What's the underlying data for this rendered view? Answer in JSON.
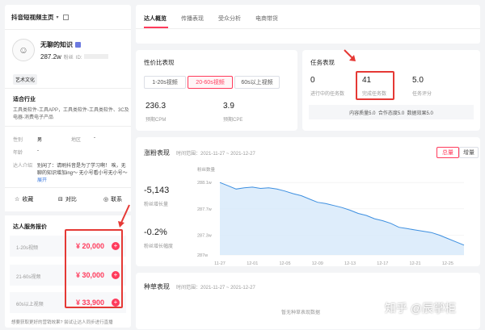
{
  "sidebar": {
    "header_title": "抖音短视频主页",
    "profile": {
      "name": "无聊的知识",
      "fans_value": "287.2w",
      "fans_label": "粉丝",
      "id_label": "ID:",
      "tag": "艺术文化"
    },
    "industry": {
      "title": "适合行业",
      "text_line1": "工具类软件-工具APP，工具类软件-工具类软件、3C及",
      "text_line2": "电器-消费电子产品"
    },
    "info": {
      "gender_label": "性别",
      "gender_value": "男",
      "region_label": "地区",
      "region_value": "-",
      "age_label": "年龄",
      "age_value": "-",
      "intro_label": "达人介绍",
      "intro_line1": "别闲了：请刷抖音是为了学习啊！ 唉，无",
      "intro_line2": "聊的知识增加ing～ 无小号看小号无小号～",
      "expand": "展开"
    },
    "actions": {
      "collect": "收藏",
      "compare": "对比",
      "contact": "联系"
    },
    "pricing": {
      "title": "达人服务报价",
      "rows": [
        {
          "label": "1-20s视频",
          "price": "¥ 20,000"
        },
        {
          "label": "21-60s视频",
          "price": "¥ 30,000"
        },
        {
          "label": "60s以上视频",
          "price": "¥ 33,900"
        }
      ],
      "footer": "想要获取更好的营销效果? 尝试让达人同步进行直播"
    }
  },
  "tabs": [
    "达人概览",
    "传播表现",
    "受众分析",
    "电商带货"
  ],
  "cost": {
    "title": "性价比表现",
    "buttons": [
      "1-20s视频",
      "20-60s视频",
      "60s以上视频"
    ],
    "cpm_value": "236.3",
    "cpm_label": "预期CPM",
    "cpe_value": "3.9",
    "cpe_label": "预期CPE"
  },
  "task": {
    "title": "任务表现",
    "in_progress_value": "0",
    "in_progress_label": "进行中的任务数",
    "done_value": "41",
    "done_label": "完成任务数",
    "score_value": "5.0",
    "score_label": "任务评分",
    "quality": "内容质量5.0  合作态度5.0  数据效果5.0"
  },
  "fans": {
    "title": "涨粉表现",
    "range": "时间范围：2021-11-27 ~ 2021-12-27",
    "toggle_total": "总量",
    "toggle_increase": "增量",
    "growth_value": "-5,143",
    "growth_label": "粉丝增长量",
    "rate_value": "-0.2%",
    "rate_label": "粉丝增长幅度",
    "axis_title": "粉丝数量"
  },
  "seed": {
    "title": "种草表现",
    "range": "时间范围：2021-11-27 ~ 2021-12-27",
    "empty": "暂无种草表现数据"
  },
  "watermark": "知乎 @辰掌柜",
  "colors": {
    "accent": "#ff3b5c",
    "highlight": "#e53935",
    "line": "#3d8fe0"
  },
  "chart_data": {
    "type": "area",
    "ylabel": "粉丝数量",
    "yticks": [
      "288.1w",
      "287.7w",
      "287.3w",
      "287w"
    ],
    "ylim": [
      287.0,
      288.2
    ],
    "x": [
      "11-27",
      "11-28",
      "11-29",
      "11-30",
      "12-01",
      "12-02",
      "12-03",
      "12-04",
      "12-05",
      "12-06",
      "12-07",
      "12-08",
      "12-09",
      "12-10",
      "12-11",
      "12-12",
      "12-13",
      "12-14",
      "12-15",
      "12-16",
      "12-17",
      "12-18",
      "12-19",
      "12-20",
      "12-21",
      "12-22",
      "12-23",
      "12-24",
      "12-25",
      "12-26",
      "12-27"
    ],
    "xticks": [
      "11-27",
      "12-01",
      "12-05",
      "12-09",
      "12-13",
      "12-17",
      "12-21",
      "12-25"
    ],
    "series": [
      {
        "values": [
          288.1,
          288.05,
          288.0,
          288.02,
          288.03,
          288.01,
          288.02,
          288.0,
          287.97,
          287.93,
          287.9,
          287.85,
          287.8,
          287.78,
          287.75,
          287.72,
          287.68,
          287.63,
          287.6,
          287.55,
          287.52,
          287.48,
          287.42,
          287.4,
          287.38,
          287.36,
          287.34,
          287.3,
          287.25,
          287.2,
          287.15
        ]
      }
    ]
  }
}
